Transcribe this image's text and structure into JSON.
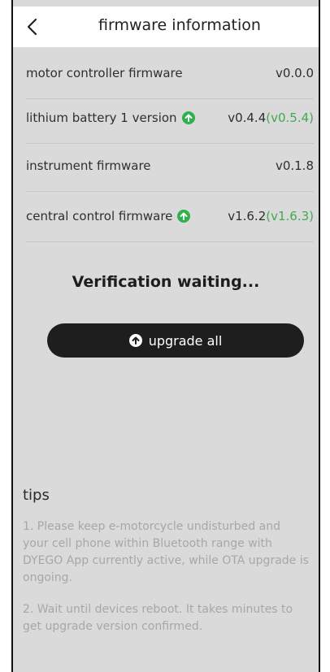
{
  "header": {
    "title": "firmware information",
    "back_icon": "chevron-left-icon"
  },
  "firmware": [
    {
      "name": "motor controller firmware",
      "version": "v0.0.0",
      "new_version": "",
      "has_update": false
    },
    {
      "name": "lithium battery 1 version",
      "version": "v0.4.4",
      "new_version": "(v0.5.4)",
      "has_update": true
    },
    {
      "name": "instrument firmware",
      "version": "v0.1.8",
      "new_version": "",
      "has_update": false
    },
    {
      "name": "central control firmware",
      "version": "v1.6.2",
      "new_version": "(v1.6.3)",
      "has_update": true
    }
  ],
  "status": "Verification waiting...",
  "upgrade_button": {
    "label": "upgrade all",
    "icon": "arrow-up-circle-icon"
  },
  "tips": {
    "title": "tips",
    "items": [
      "1. Please keep e-motorcycle undisturbed and your cell phone within Bluetooth range with DYEGO App currently active, while OTA upgrade is ongoing.",
      "2. Wait until devices reboot. It takes minutes to get upgrade version confirmed."
    ]
  },
  "colors": {
    "background": "#dadada",
    "header_bg": "#ffffff",
    "update_green": "#2fb04b",
    "new_version_green": "#45a84f",
    "button_bg": "#1e1e1e",
    "tip_text": "#a7a7a7"
  }
}
